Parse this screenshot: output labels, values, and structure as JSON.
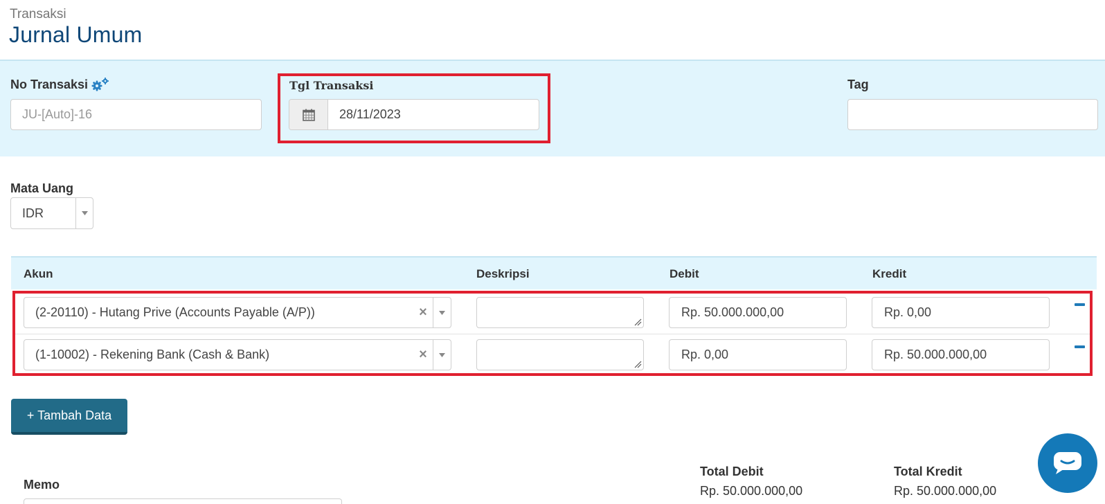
{
  "header": {
    "breadcrumb": "Transaksi",
    "title": "Jurnal Umum"
  },
  "form": {
    "no_transaksi": {
      "label": "No Transaksi",
      "placeholder": "JU-[Auto]-16"
    },
    "tgl_transaksi": {
      "label": "Tgl Transaksi",
      "value": "28/11/2023"
    },
    "tag": {
      "label": "Tag",
      "value": ""
    },
    "mata_uang": {
      "label": "Mata Uang",
      "value": "IDR"
    }
  },
  "table": {
    "headers": {
      "akun": "Akun",
      "deskripsi": "Deskripsi",
      "debit": "Debit",
      "kredit": "Kredit"
    },
    "rows": [
      {
        "akun": "(2-20110) - Hutang Prive (Accounts Payable (A/P))",
        "deskripsi": "",
        "debit": "Rp. 50.000.000,00",
        "kredit": "Rp. 0,00"
      },
      {
        "akun": "(1-10002) - Rekening Bank (Cash & Bank)",
        "deskripsi": "",
        "debit": "Rp. 0,00",
        "kredit": "Rp. 50.000.000,00"
      }
    ]
  },
  "actions": {
    "add_row": "+ Tambah Data"
  },
  "memo": {
    "label": "Memo"
  },
  "totals": {
    "debit_label": "Total Debit",
    "debit_value": "Rp. 50.000.000,00",
    "kredit_label": "Total Kredit",
    "kredit_value": "Rp. 50.000.000,00"
  },
  "icons": {
    "gear": "gear-icon",
    "calendar": "calendar-icon",
    "caret": "chevron-down-icon",
    "clear": "close-icon",
    "remove_row": "minus-icon",
    "chat": "chat-icon"
  },
  "colors": {
    "title": "#0e4677",
    "panel_bg": "#e1f5fd",
    "highlight": "#e02030",
    "button": "#226b88",
    "chat": "#1479b8"
  }
}
